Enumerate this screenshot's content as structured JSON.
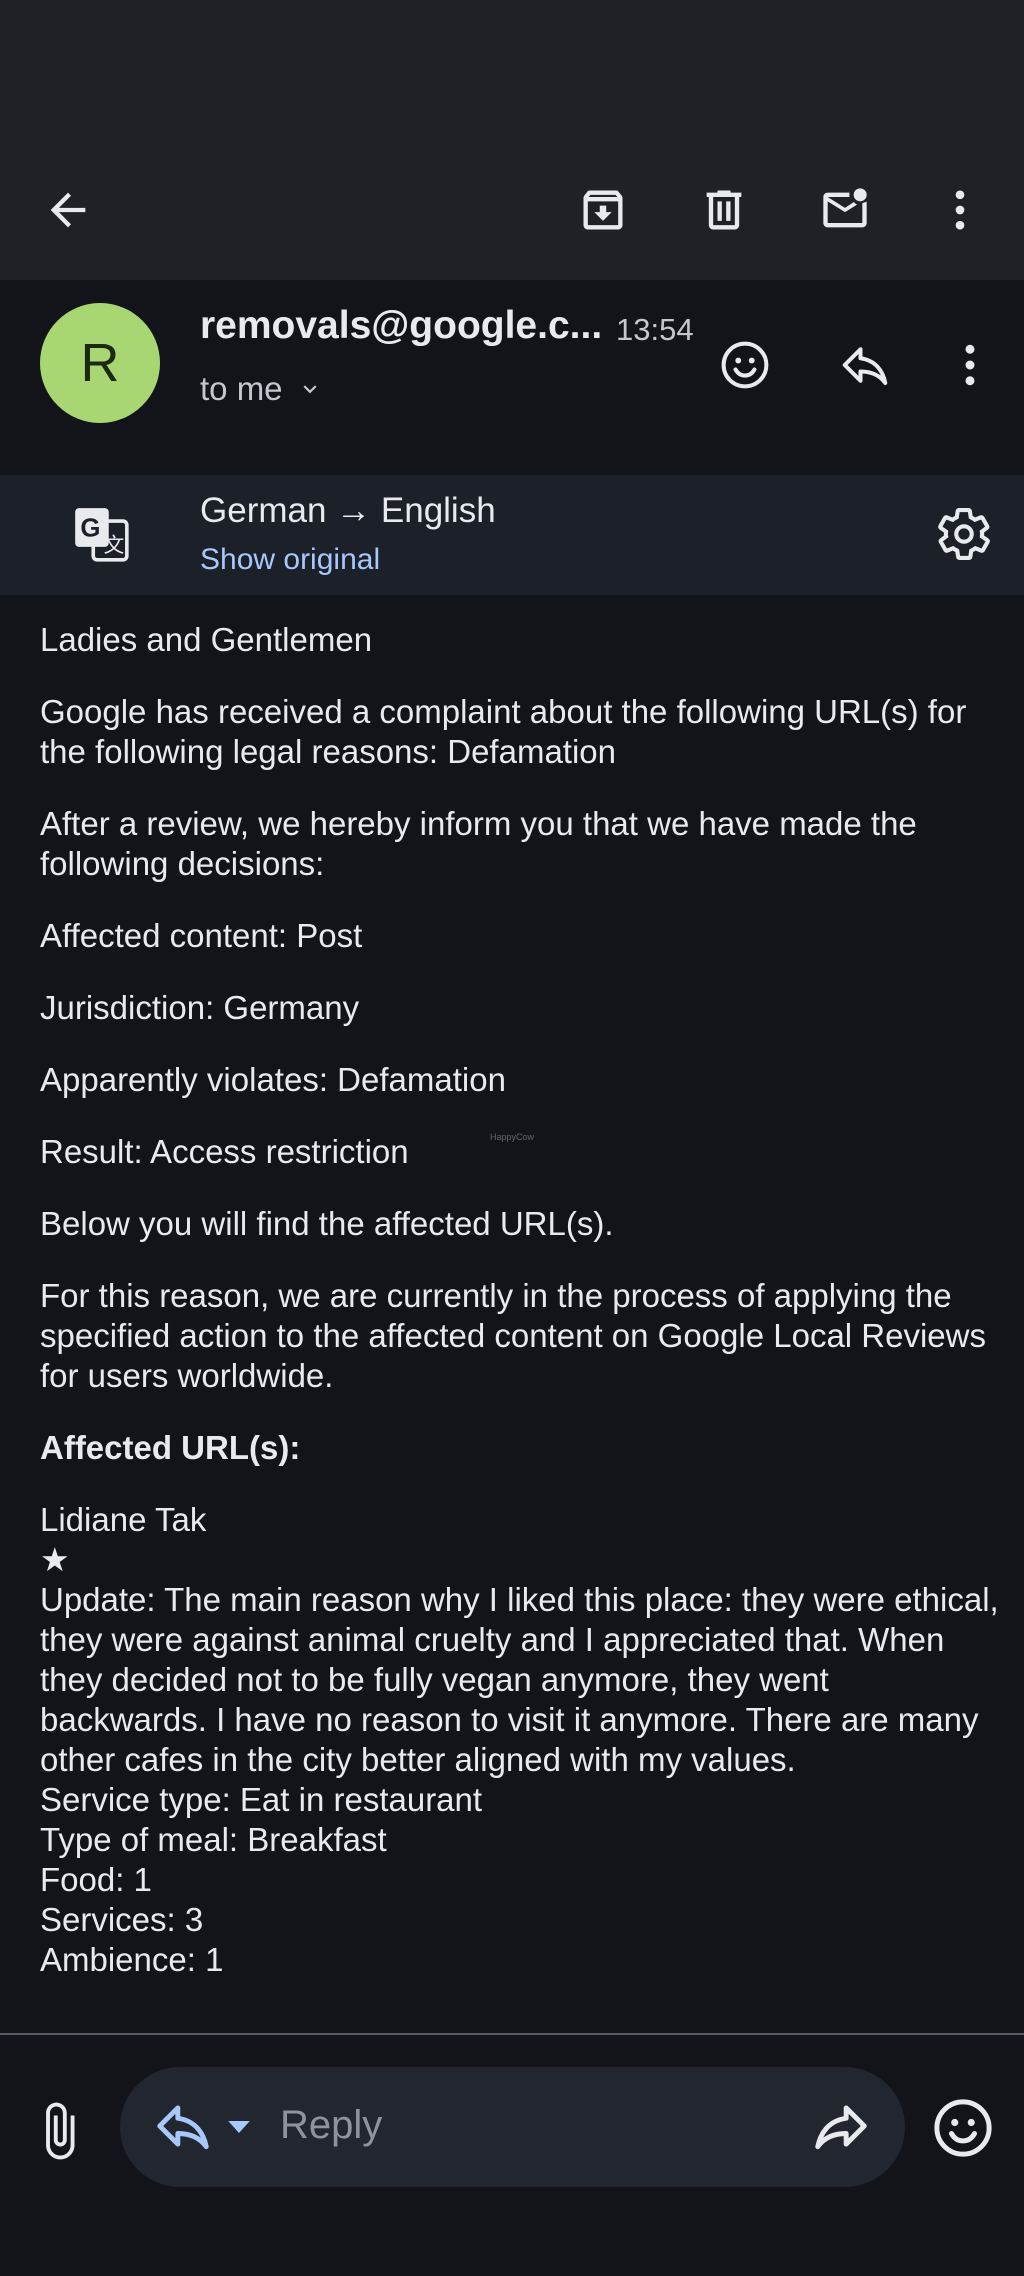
{
  "toolbar": {
    "back": "back-arrow-icon",
    "archive": "archive-icon",
    "delete": "trash-icon",
    "mark_unread": "mark-unread-icon",
    "more": "more-vert-icon"
  },
  "email": {
    "sender_initial": "R",
    "sender": "removals@google.c...",
    "time": "13:54",
    "recipient": "to me"
  },
  "translation": {
    "languages": "German → English",
    "show_original": "Show original"
  },
  "body": {
    "greeting": "Ladies and Gentlemen",
    "p1": "Google has received a complaint about the following URL(s) for the following legal reasons: Defamation",
    "p2": "After a review, we hereby inform you that we have made the following decisions:",
    "affected_content": "Affected content: Post",
    "jurisdiction": "Jurisdiction: Germany",
    "violates": "Apparently violates: Defamation",
    "result": "Result: Access restriction",
    "below": "Below you will find the affected URL(s).",
    "p3": "For this reason, we are currently in the process of applying the specified action to the affected content on Google Local Reviews for users worldwide.",
    "affected_urls_heading": "Affected URL(s):",
    "review": {
      "author": "Lidiane Tak",
      "stars": "★",
      "text": "Update: The main reason why I liked this place: they were ethical, they were against animal cruelty and I appreciated that. When they decided not to be fully vegan anymore, they went backwards. I have no reason to visit it anymore. There are many other cafes in the city better aligned with my values.",
      "service_type": "Service type: Eat in restaurant",
      "meal_type": "Type of meal: Breakfast",
      "food": "Food: 1",
      "services": "Services: 3",
      "ambience": "Ambience: 1"
    }
  },
  "watermark": "HappyCow",
  "reply_bar": {
    "reply_label": "Reply"
  },
  "colors": {
    "background": "#12141a",
    "toolbar": "#1f2127",
    "translate_bar": "#1c2028",
    "avatar": "#a8d672",
    "link": "#a8c7fa"
  }
}
